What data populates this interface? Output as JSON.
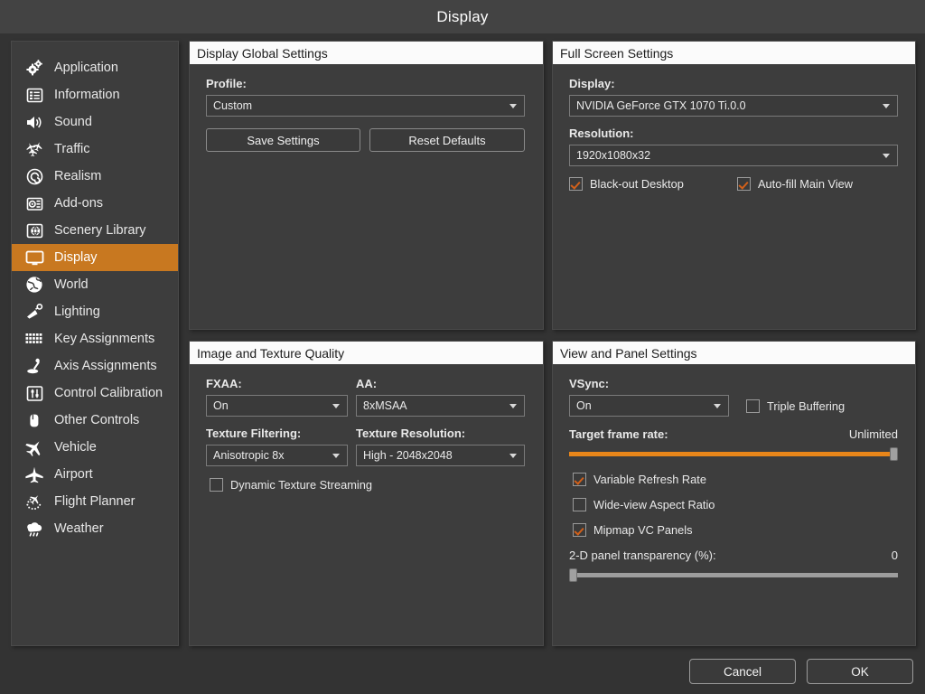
{
  "window": {
    "title": "Display"
  },
  "sidebar": {
    "items": [
      {
        "label": "Application",
        "icon": "gears-icon",
        "selected": false
      },
      {
        "label": "Information",
        "icon": "list-card-icon",
        "selected": false
      },
      {
        "label": "Sound",
        "icon": "speaker-icon",
        "selected": false
      },
      {
        "label": "Traffic",
        "icon": "traffic-aircraft-icon",
        "selected": false
      },
      {
        "label": "Realism",
        "icon": "spiral-dial-icon",
        "selected": false
      },
      {
        "label": "Add-ons",
        "icon": "addon-module-icon",
        "selected": false
      },
      {
        "label": "Scenery Library",
        "icon": "globe-card-icon",
        "selected": false
      },
      {
        "label": "Display",
        "icon": "monitor-icon",
        "selected": true
      },
      {
        "label": "World",
        "icon": "globe-icon",
        "selected": false
      },
      {
        "label": "Lighting",
        "icon": "lamp-icon",
        "selected": false
      },
      {
        "label": "Key Assignments",
        "icon": "keyboard-icon",
        "selected": false
      },
      {
        "label": "Axis Assignments",
        "icon": "joystick-icon",
        "selected": false
      },
      {
        "label": "Control Calibration",
        "icon": "sliders-box-icon",
        "selected": false
      },
      {
        "label": "Other Controls",
        "icon": "yoke-icon",
        "selected": false
      },
      {
        "label": "Vehicle",
        "icon": "airplane-tilt-icon",
        "selected": false
      },
      {
        "label": "Airport",
        "icon": "airplane-icon",
        "selected": false
      },
      {
        "label": "Flight Planner",
        "icon": "flightplan-icon",
        "selected": false
      },
      {
        "label": "Weather",
        "icon": "cloud-rain-icon",
        "selected": false
      }
    ]
  },
  "panels": {
    "global": {
      "title": "Display Global Settings",
      "profile_label": "Profile:",
      "profile_value": "Custom",
      "save_label": "Save Settings",
      "reset_label": "Reset Defaults"
    },
    "fullscreen": {
      "title": "Full Screen Settings",
      "display_label": "Display:",
      "display_value": "NVIDIA GeForce GTX 1070 Ti.0.0",
      "resolution_label": "Resolution:",
      "resolution_value": "1920x1080x32",
      "blackout_label": "Black-out Desktop",
      "blackout_checked": true,
      "autofill_label": "Auto-fill Main View",
      "autofill_checked": true
    },
    "image": {
      "title": "Image and Texture Quality",
      "fxaa_label": "FXAA:",
      "fxaa_value": "On",
      "aa_label": "AA:",
      "aa_value": "8xMSAA",
      "filtering_label": "Texture Filtering:",
      "filtering_value": "Anisotropic 8x",
      "resolution_label": "Texture Resolution:",
      "resolution_value": "High - 2048x2048",
      "dynamic_label": "Dynamic Texture Streaming",
      "dynamic_checked": false
    },
    "view": {
      "title": "View and Panel Settings",
      "vsync_label": "VSync:",
      "vsync_value": "On",
      "triple_label": "Triple Buffering",
      "triple_checked": false,
      "framerate_label": "Target frame rate:",
      "framerate_value": "Unlimited",
      "framerate_percent": 100,
      "vrr_label": "Variable Refresh Rate",
      "vrr_checked": true,
      "wideview_label": "Wide-view Aspect Ratio",
      "wideview_checked": false,
      "mipmap_label": "Mipmap VC Panels",
      "mipmap_checked": true,
      "transparency_label": "2-D panel transparency (%):",
      "transparency_value": "0",
      "transparency_percent": 0
    }
  },
  "footer": {
    "cancel_label": "Cancel",
    "ok_label": "OK"
  },
  "colors": {
    "accent": "#c87820",
    "slider_fill": "#e8861a",
    "check": "#d2601a",
    "window_bg": "#333333",
    "panel_bg": "#3d3d3d",
    "header_bg": "#fbfbfb"
  }
}
